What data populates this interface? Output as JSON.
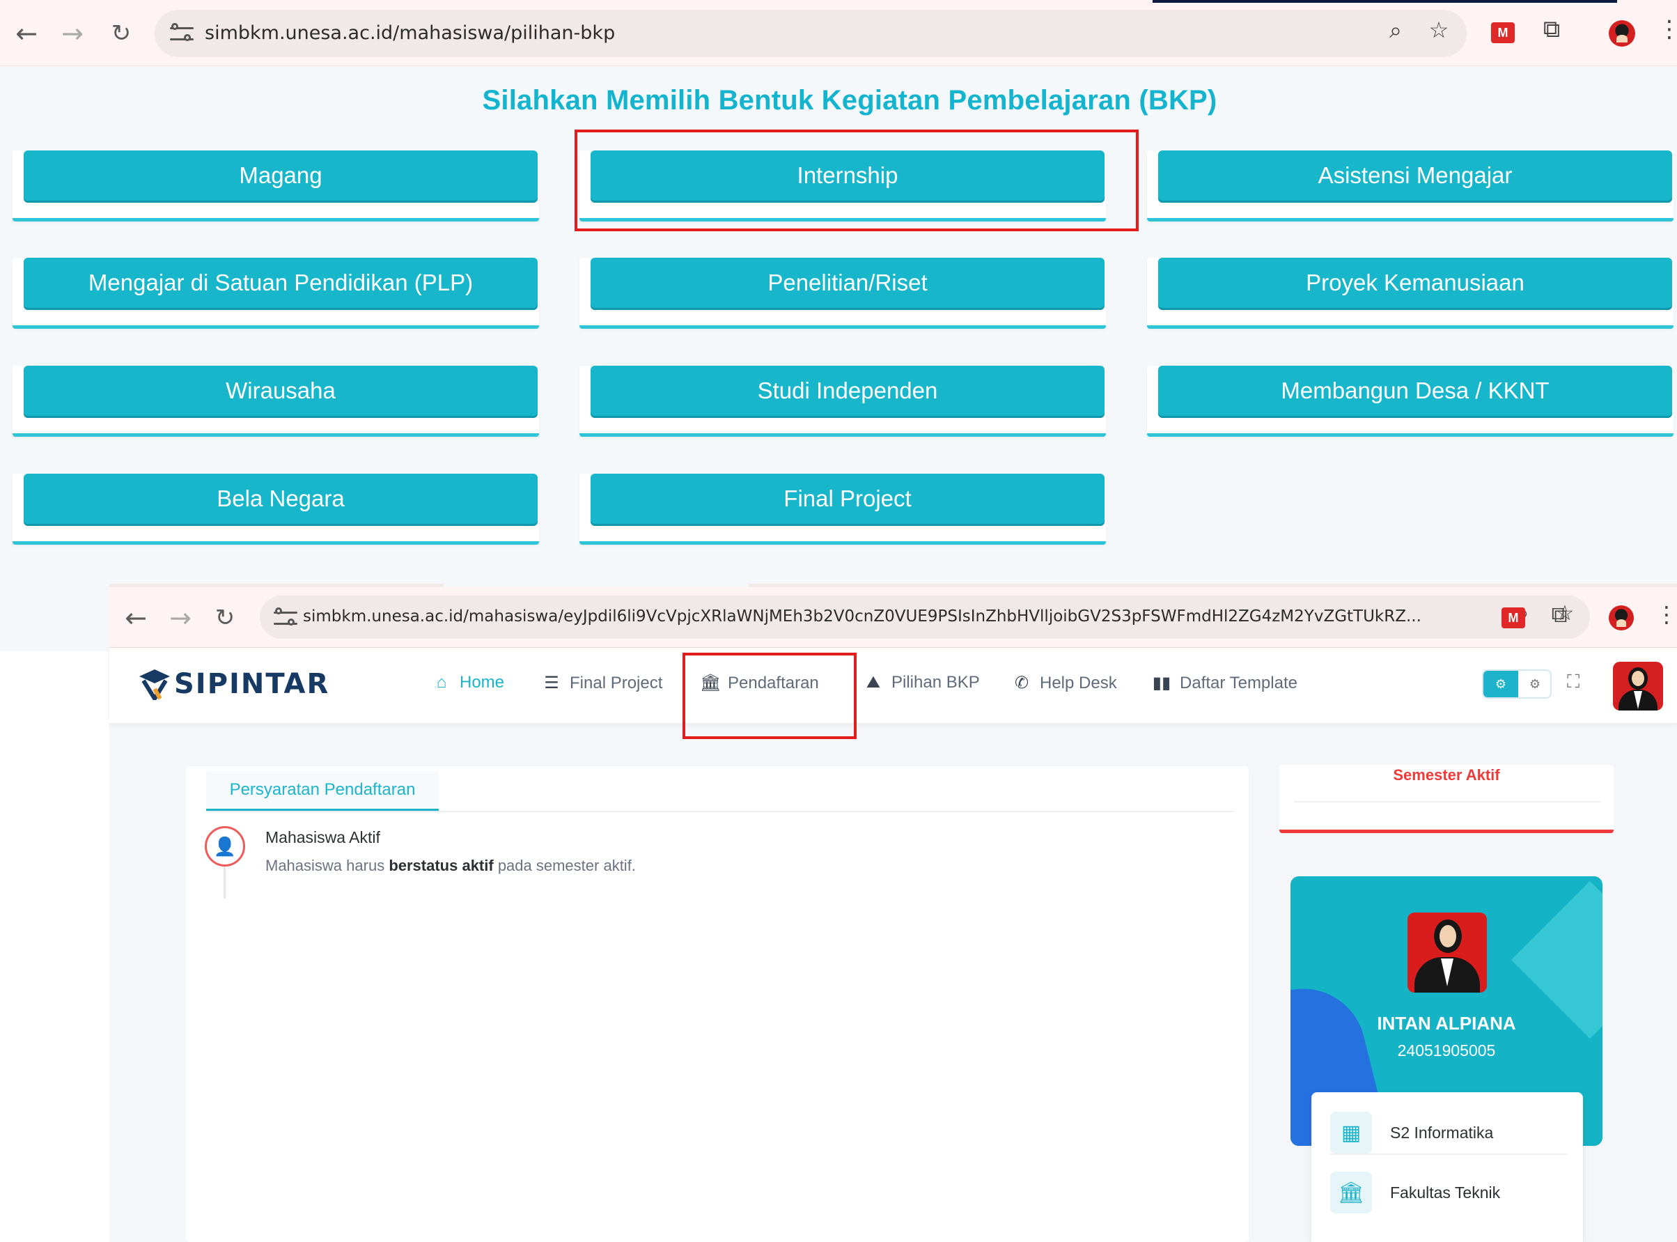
{
  "browser_top": {
    "url": "simbkm.unesa.ac.id/mahasiswa/pilihan-bkp",
    "icons": [
      "back-arrow",
      "forward-arrow",
      "reload",
      "site-settings",
      "zoom",
      "bookmark-star",
      "extension",
      "extensions-puzzle",
      "profile",
      "more-menu"
    ]
  },
  "bkp": {
    "title": "Silahkan Memilih Bentuk Kegiatan Pembelajaran (BKP)",
    "options": [
      "Magang",
      "Internship",
      "Asistensi Mengajar",
      "Mengajar di Satuan Pendidikan (PLP)",
      "Penelitian/Riset",
      "Proyek Kemanusiaan",
      "Wirausaha",
      "Studi Independen",
      "Membangun Desa / KKNT",
      "Bela Negara",
      "Final Project"
    ],
    "highlighted": "Internship"
  },
  "browser_bottom": {
    "url": "simbkm.unesa.ac.id/mahasiswa/eyJpdil6li9VcVpjcXRlaWNjMEh3b2V0cnZ0VUE9PSIsInZhbHVlljoibGV2S3pFSWFmdHl2ZG4zM2YvZGtTUkRZ..."
  },
  "app": {
    "brand": "SIPINTAR",
    "menu": [
      {
        "label": "Home",
        "icon": "home-icon",
        "active": true
      },
      {
        "label": "Final Project",
        "icon": "list-icon",
        "active": false
      },
      {
        "label": "Pendaftaran",
        "icon": "bank-icon",
        "active": false
      },
      {
        "label": "Pilihan BKP",
        "icon": "road-icon",
        "active": false
      },
      {
        "label": "Help Desk",
        "icon": "phone-icon",
        "active": false
      },
      {
        "label": "Daftar Template",
        "icon": "book-icon",
        "active": false
      }
    ],
    "highlighted_menu": "Pendaftaran",
    "tab": "Persyaratan Pendaftaran",
    "requirement": {
      "title": "Mahasiswa Aktif",
      "desc_pre": "Mahasiswa harus ",
      "desc_bold": "berstatus aktif",
      "desc_post": " pada semester aktif."
    },
    "semester_title": "Semester Aktif",
    "profile": {
      "name": "INTAN ALPIANA",
      "nim": "24051905005",
      "info": [
        {
          "icon": "building-icon",
          "text": "S2 Informatika"
        },
        {
          "icon": "institution-icon",
          "text": "Fakultas Teknik"
        }
      ]
    }
  },
  "colors": {
    "accent": "#17b6cb",
    "highlight_box": "#e11d1d",
    "semester": "#ef3a3a",
    "brand_text": "#163a63"
  }
}
